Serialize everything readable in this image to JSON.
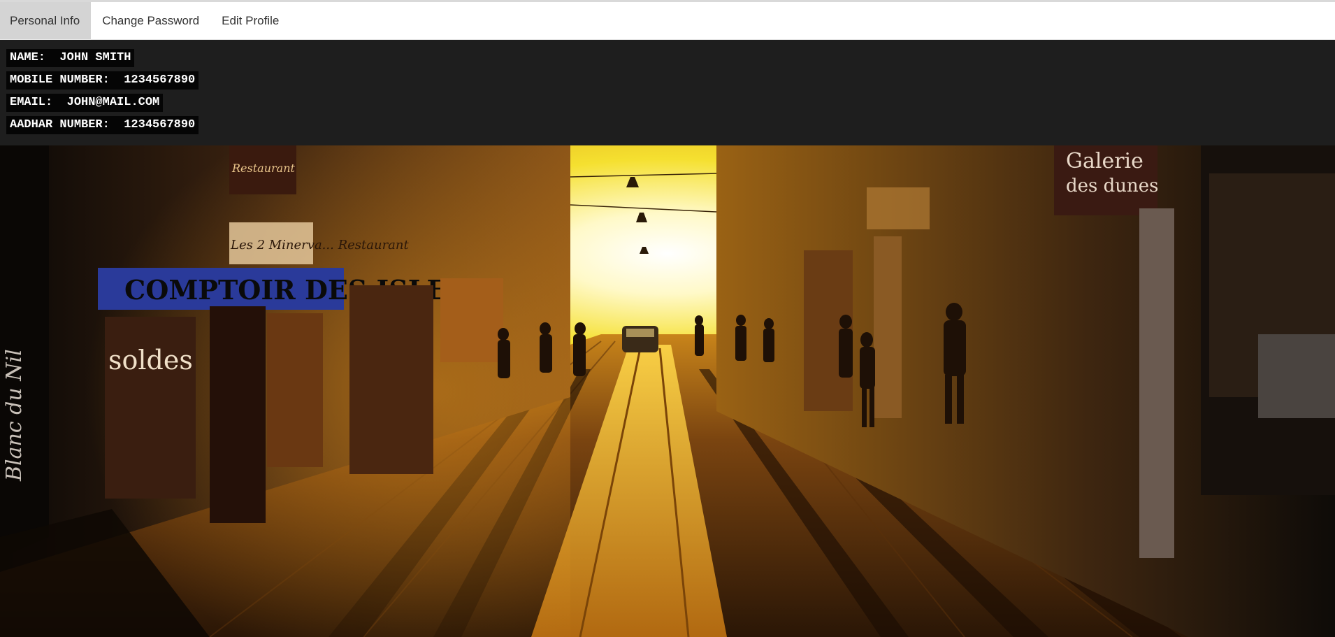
{
  "tabs": [
    {
      "label": "Personal Info",
      "active": true
    },
    {
      "label": "Change Password",
      "active": false
    },
    {
      "label": "Edit Profile",
      "active": false
    }
  ],
  "profile": {
    "name_label": "NAME:",
    "name_value": "JOHN SMITH",
    "mobile_label": "MOBILE NUMBER:",
    "mobile_value": "1234567890",
    "email_label": "EMAIL:",
    "email_value": "JOHN@MAIL.COM",
    "aadhar_label": "AADHAR NUMBER:",
    "aadhar_value": "1234567890"
  },
  "banner": {
    "signs": {
      "comptoir": "COMPTOIR DES ISLES",
      "restaurant": "Restaurant",
      "minerva": "Les 2 Minerva... Restaurant",
      "soldes": "soldes",
      "galerie_line1": "Galerie",
      "galerie_line2": "des dunes",
      "blanc": "Blanc du Nil"
    }
  },
  "colors": {
    "tab_active_bg": "#d4d4d4",
    "panel_bg": "#1e1e1e",
    "chip_bg": "#050505",
    "chip_text": "#ffffff",
    "sun": "#fff9c8",
    "street_glow": "#e89a1a"
  }
}
